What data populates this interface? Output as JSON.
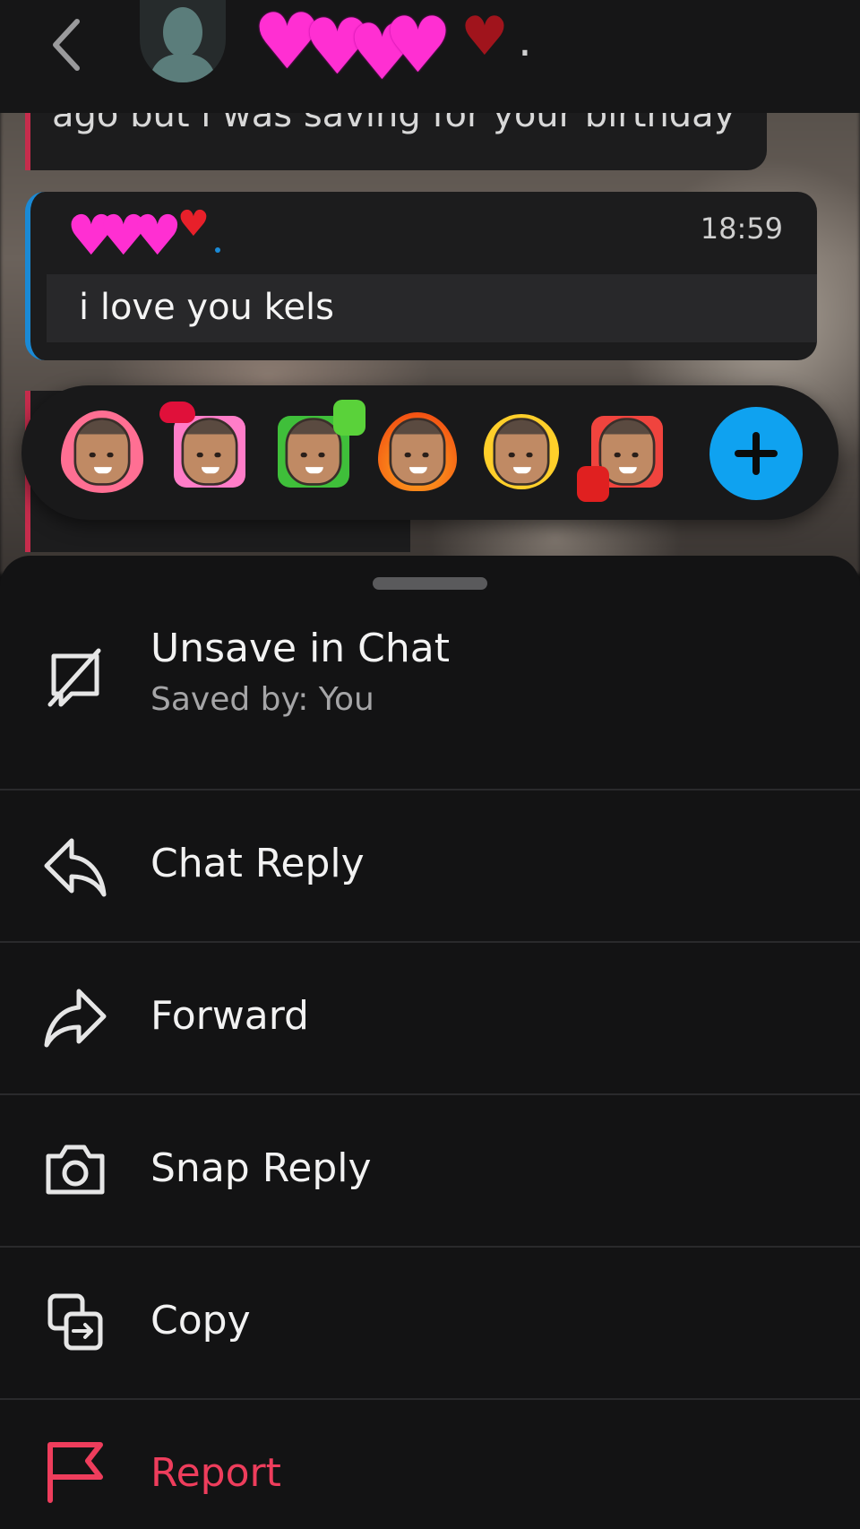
{
  "header": {
    "back_icon": "chevron-left-icon",
    "avatar_icon": "person-silhouette-icon",
    "title_dot": "."
  },
  "messages": {
    "previous_text": "ago but i was saving for your birthday",
    "current": {
      "time": "18:59",
      "dot": ".",
      "body": "i love you kels"
    }
  },
  "reactions": {
    "items": [
      {
        "name": "heart-bitmoji"
      },
      {
        "name": "kiss-bitmoji"
      },
      {
        "name": "thumbs-up-bitmoji"
      },
      {
        "name": "fire-bitmoji"
      },
      {
        "name": "crying-laughing-bitmoji"
      },
      {
        "name": "thumbs-down-bitmoji"
      }
    ],
    "add_icon": "plus-icon"
  },
  "menu": {
    "unsave": {
      "label": "Unsave in Chat",
      "sub": "Saved by: You",
      "icon": "unsave-icon"
    },
    "chat_reply": {
      "label": "Chat Reply",
      "icon": "reply-arrow-icon"
    },
    "forward": {
      "label": "Forward",
      "icon": "forward-arrow-icon"
    },
    "snap_reply": {
      "label": "Snap Reply",
      "icon": "camera-icon"
    },
    "copy": {
      "label": "Copy",
      "icon": "copy-icon"
    },
    "report": {
      "label": "Report",
      "icon": "flag-icon"
    }
  },
  "colors": {
    "accent_blue": "#0fa2f0",
    "report_red": "#ee3d5c",
    "saved_bar_red": "#c62c4c",
    "heart_pink": "#ff2fd2"
  }
}
